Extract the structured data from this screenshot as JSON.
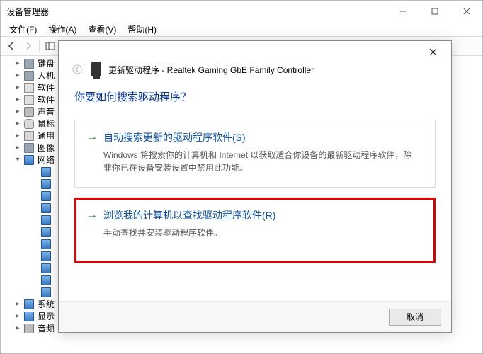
{
  "window": {
    "title": "设备管理器"
  },
  "menu": {
    "file": "文件(F)",
    "action": "操作(A)",
    "view": "查看(V)",
    "help": "帮助(H)"
  },
  "tree": {
    "items": [
      {
        "label": "键盘",
        "icon": "gray",
        "toggle": "▸",
        "indent": 16
      },
      {
        "label": "人机",
        "icon": "gray",
        "toggle": "▸",
        "indent": 16
      },
      {
        "label": "软件",
        "icon": "chip",
        "toggle": "▸",
        "indent": 16
      },
      {
        "label": "软件",
        "icon": "chip",
        "toggle": "▸",
        "indent": 16
      },
      {
        "label": "声音",
        "icon": "speaker",
        "toggle": "▸",
        "indent": 16
      },
      {
        "label": "鼠标",
        "icon": "mouse",
        "toggle": "▸",
        "indent": 16
      },
      {
        "label": "通用",
        "icon": "usb",
        "toggle": "▸",
        "indent": 16
      },
      {
        "label": "图像",
        "icon": "gray",
        "toggle": "▸",
        "indent": 16
      },
      {
        "label": "网络",
        "icon": "net",
        "toggle": "▾",
        "indent": 16
      },
      {
        "label": "",
        "icon": "net",
        "toggle": "",
        "indent": 40
      },
      {
        "label": "",
        "icon": "net",
        "toggle": "",
        "indent": 40
      },
      {
        "label": "",
        "icon": "net",
        "toggle": "",
        "indent": 40
      },
      {
        "label": "",
        "icon": "net",
        "toggle": "",
        "indent": 40
      },
      {
        "label": "",
        "icon": "net",
        "toggle": "",
        "indent": 40
      },
      {
        "label": "",
        "icon": "net",
        "toggle": "",
        "indent": 40
      },
      {
        "label": "",
        "icon": "net",
        "toggle": "",
        "indent": 40
      },
      {
        "label": "",
        "icon": "net",
        "toggle": "",
        "indent": 40
      },
      {
        "label": "",
        "icon": "net",
        "toggle": "",
        "indent": 40
      },
      {
        "label": "",
        "icon": "net",
        "toggle": "",
        "indent": 40
      },
      {
        "label": "",
        "icon": "net",
        "toggle": "",
        "indent": 40
      },
      {
        "label": "系统",
        "icon": "monitor",
        "toggle": "▸",
        "indent": 16
      },
      {
        "label": "显示",
        "icon": "monitor",
        "toggle": "▸",
        "indent": 16
      },
      {
        "label": "音频",
        "icon": "speaker",
        "toggle": "▸",
        "indent": 16
      }
    ]
  },
  "dialog": {
    "title": "更新驱动程序 - Realtek Gaming GbE Family Controller",
    "question": "你要如何搜索驱动程序？",
    "option1": {
      "title": "自动搜索更新的驱动程序软件(S)",
      "desc": "Windows 将搜索你的计算机和 Internet 以获取适合你设备的最新驱动程序软件，除非你已在设备安装设置中禁用此功能。"
    },
    "option2": {
      "title": "浏览我的计算机以查找驱动程序软件(R)",
      "desc": "手动查找并安装驱动程序软件。"
    },
    "cancel": "取消"
  }
}
